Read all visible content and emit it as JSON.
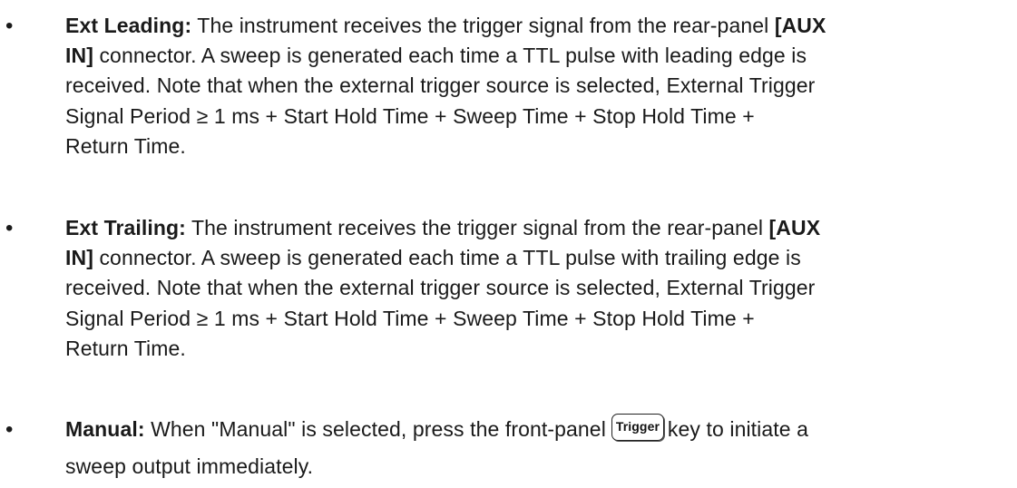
{
  "items": [
    {
      "bullet": "•",
      "term": "Ext Leading:",
      "lines": [
        {
          "pre": " The instrument receives the trigger signal from the rear-panel ",
          "bold": "[AUX"
        },
        {
          "bold": "IN]",
          "post": " connector. A sweep is generated each time a TTL pulse with leading edge is"
        },
        {
          "text": "received. Note that when the external trigger source is selected, External Trigger"
        },
        {
          "text": "Signal Period ≥ 1 ms + Start Hold Time + Sweep Time + Stop Hold Time +"
        },
        {
          "text": "Return Time."
        }
      ]
    },
    {
      "bullet": "•",
      "term": "Ext Trailing:",
      "lines": [
        {
          "pre": " The instrument receives the trigger signal from the rear-panel ",
          "bold": "[AUX"
        },
        {
          "bold": "IN]",
          "post": " connector. A sweep is generated each time a TTL pulse with trailing edge is"
        },
        {
          "text": "received. Note that when the external trigger source is selected, External Trigger"
        },
        {
          "text": "Signal Period ≥ 1 ms + Start Hold Time + Sweep Time + Stop Hold Time +"
        },
        {
          "text": "Return Time."
        }
      ]
    },
    {
      "bullet": "•",
      "term": "Manual:",
      "line1_pre": " When \"Manual\" is selected, press the front-panel",
      "key_label": "Trigger",
      "line1_post": "key to initiate a",
      "line2": "sweep output immediately."
    }
  ]
}
